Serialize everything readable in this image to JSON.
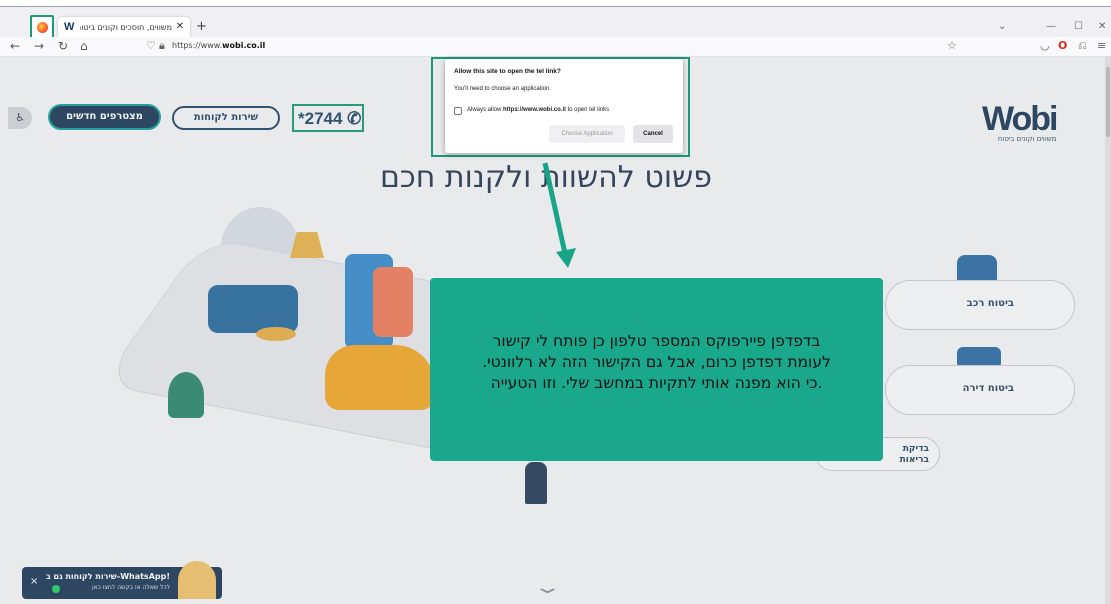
{
  "browser": {
    "tab_title": "משווים, חוסכים וקונים ביטוח ב",
    "tab_favicon": "W",
    "new_tab": "+",
    "url_prefix": "https://www.",
    "url_domain": "wobi.co.il",
    "window_controls": [
      "⌄",
      "—",
      "☐",
      "✕"
    ]
  },
  "header": {
    "new_customers": "מצטרפים חדשים",
    "customer_service": "שירות לקוחות",
    "phone": "*2744",
    "logo": "Wobi",
    "logo_tagline": "משווים וקונים ביטוח",
    "accessibility": "♿"
  },
  "hero": {
    "headline": "פשוט להשוות ולקנות חכם"
  },
  "cards": {
    "car_insurance": "ביטוח רכב",
    "home_insurance": "ביטוח דירה",
    "health_check_line1": "בדיקת",
    "health_check_line2": "בריאות"
  },
  "dialog": {
    "title": "Allow this site to open the tel link?",
    "body": "You'll need to choose an application.",
    "checkbox_prefix": "Always allow ",
    "checkbox_url": "https://www.wobi.co.il",
    "checkbox_suffix": " to open tel links",
    "choose_btn": "Choose Application",
    "cancel_btn": "Cancel"
  },
  "whatsapp": {
    "title": "!WhatsApp-שירות לקוחות גם ב",
    "subtitle": "לכל שאלה או בקשה לחצו כאן",
    "close": "×"
  },
  "annotation": {
    "line1": "בדפדפן פיירפוקס המספר טלפון כן פותח לי קישור",
    "line2": "לעומת דפדפן כרום, אבל גם הקישור הזה לא רלוונטי.",
    "line3": ".כי הוא מפנה אותי לתקיות במחשב שלי. וזו הטעייה"
  },
  "colors": {
    "accent": "#1b9a79",
    "callout": "#1aa88c",
    "brand_navy": "#1f3d5c"
  }
}
